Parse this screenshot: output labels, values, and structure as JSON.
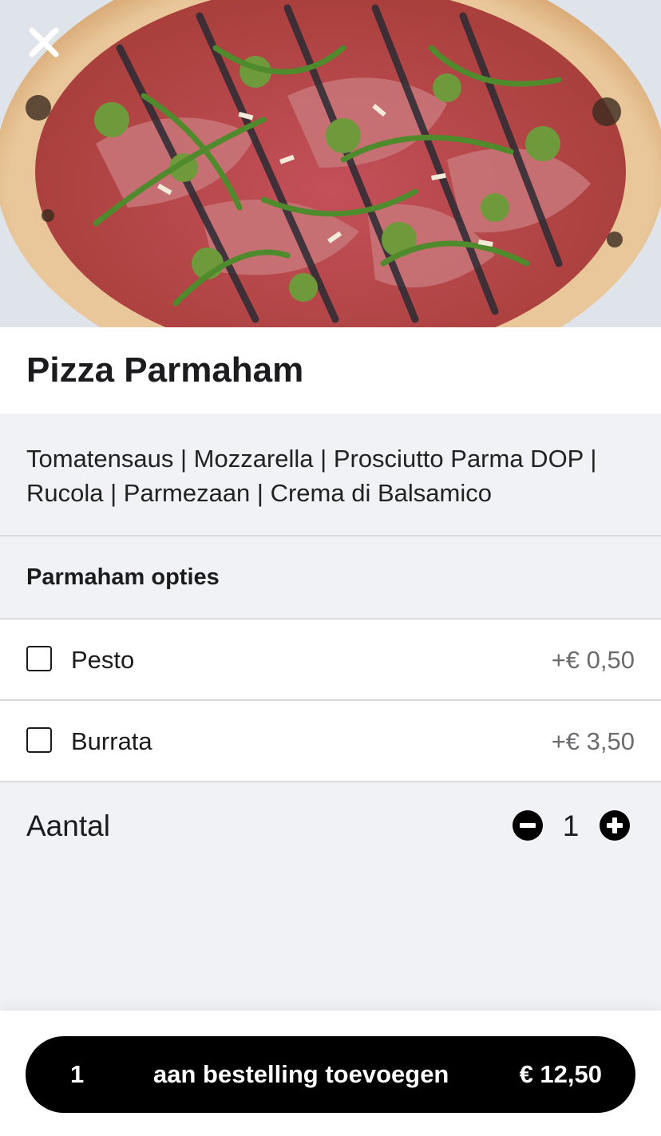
{
  "product": {
    "image_alt": "pizza-photo",
    "title": "Pizza Parmaham",
    "description": "Tomatensaus | Mozzarella | Prosciutto Parma DOP | Rucola | Parmezaan | Crema di Balsamico"
  },
  "options_section": {
    "title": "Parmaham opties",
    "options": [
      {
        "label": "Pesto",
        "price": "+€ 0,50",
        "checked": false
      },
      {
        "label": "Burrata",
        "price": "+€ 3,50",
        "checked": false
      }
    ]
  },
  "quantity": {
    "label": "Aantal",
    "value": "1"
  },
  "footer": {
    "count": "1",
    "label": "aan bestelling toevoegen",
    "price": "€ 12,50"
  },
  "icons": {
    "close": "close-icon",
    "minus": "minus-circle-icon",
    "plus": "plus-circle-icon"
  },
  "colors": {
    "accent": "#000000",
    "background": "#f1f2f6",
    "surface": "#ffffff",
    "price_text": "#6b6b6e"
  }
}
